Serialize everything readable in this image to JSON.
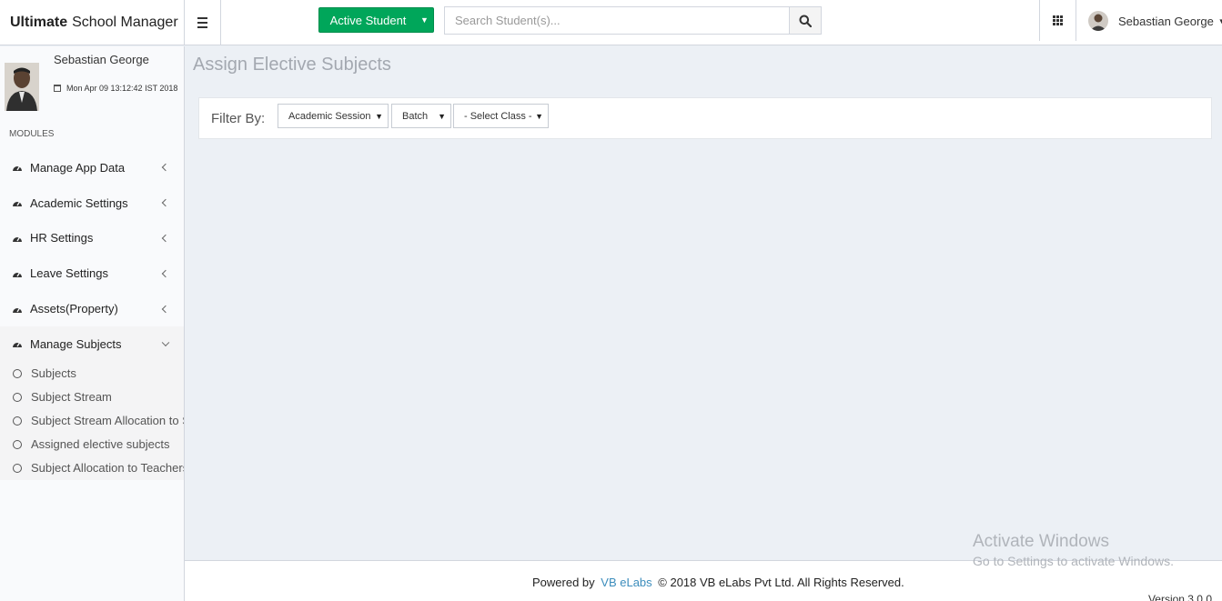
{
  "header": {
    "brand_bold": "Ultimate",
    "brand_rest": "School Manager",
    "active_student_label": "Active Student",
    "search_placeholder": "Search Student(s)...",
    "user_name": "Sebastian George"
  },
  "sidebar": {
    "user_name": "Sebastian George",
    "datetime": "Mon Apr 09 13:12:42 IST 2018",
    "modules_header": "MODULES",
    "items": [
      {
        "label": "Manage App Data"
      },
      {
        "label": "Academic Settings"
      },
      {
        "label": "HR Settings"
      },
      {
        "label": "Leave Settings"
      },
      {
        "label": "Assets(Property)"
      },
      {
        "label": "Manage Subjects"
      }
    ],
    "subitems": [
      {
        "label": "Subjects"
      },
      {
        "label": "Subject Stream"
      },
      {
        "label": "Subject Stream Allocation to Stu"
      },
      {
        "label": "Assigned elective subjects"
      },
      {
        "label": "Subject Allocation to Teachers"
      }
    ]
  },
  "main": {
    "title": "Assign Elective Subjects",
    "filter_label": "Filter By:",
    "filters": {
      "session": "Academic Session",
      "batch": "Batch",
      "class": "- Select Class -"
    }
  },
  "footer": {
    "powered_by": "Powered by",
    "company_link": "VB eLabs",
    "copyright": "© 2018 VB eLabs Pvt Ltd. All Rights Reserved.",
    "version": "Version 3.0.0"
  },
  "watermark": {
    "line1": "Activate Windows",
    "line2": "Go to Settings to activate Windows."
  },
  "colors": {
    "accent_green": "#00a65a",
    "link_blue": "#3c8dbc",
    "content_bg": "#ecf0f5"
  }
}
